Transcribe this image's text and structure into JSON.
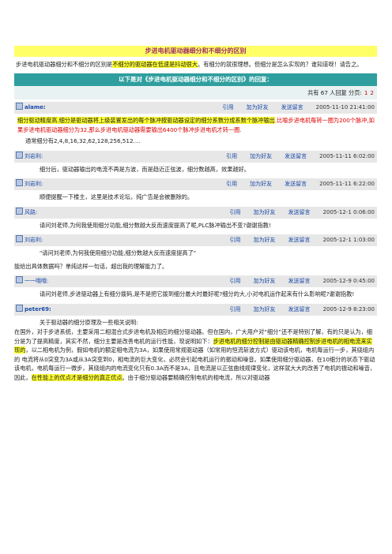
{
  "title": "步进电机驱动器细分和不细分的区别",
  "intro": {
    "pre": "步进电机驱动器细分和不细分的区别是",
    "hl": "不细分的驱动器在低速是抖动很大",
    "post": "。有细分的就很理想。但细分是怎么实现的？谁知道呀！请告之。"
  },
  "reply_header": "以下是对《步进电机驱动器细分和不细分的区别》的回复：",
  "count": {
    "text": "共有 67 人回复  分页:",
    "p1": "1",
    "p2": "2"
  },
  "actions": {
    "quote": "引用",
    "add_friend": "加为好友",
    "message": "发送留言"
  },
  "posts": [
    {
      "user": "alame:",
      "time": "2005-11-10 21:41:00",
      "hl": "细分驱动精度高.细分是驱动器将上级装置发出的每个脉冲按驱动器设定的细分系数分成系数个脉冲输出",
      "red": ".比喻步进电机每转一圈为200个脉冲,如果步进电机驱动器细分为32,那么步进电机驱动器需要输出6400个脉冲步进电机才转一圈.",
      "line2": "通常细分有2,4,8,16,32,62,128,256,512...."
    },
    {
      "user": "刘岩利:",
      "time": "2005-11-11 6:02:00",
      "text": "细分后，驱动器输出的电流不再是方波，而是趋近正弦波，细分数越高，效果越好。"
    },
    {
      "user": "刘岩利:",
      "time": "2005-11-11 6:22:00",
      "text": "顺便提醒一下楼主，这里是技术论坛，纯广告是会被删除的。"
    },
    {
      "user": "风路:",
      "time": "2005-12-1 0:06:00",
      "text": "请问刘老师,为何我使用细分功能,细分数越大反而速度提高了呢,PLC脉冲输出不变?谢谢指教!"
    },
    {
      "user": "刘岩利:",
      "time": "2005-12-1 1:03:00",
      "quote": "\"请问刘老师,为何我使用细分功能,细分数越大反而速度提高了\"",
      "text": "能给出具体数据吗？单纯这样一句话，超出我的理解能力了。"
    },
    {
      "user": "一一哦哦:",
      "time": "2005-12-9 0:45:00",
      "text": "请问刘老师,步进驱动器上有细分拨码,是不是把它拨到细分最大时最好呢?细分的大,小对电机运作起来有什么影响呢?谢谢指教!"
    },
    {
      "user": "peter69:",
      "time": "2005-12-9 8:23:00",
      "first": "关于驱动器的细分原理及一些相关说明:",
      "body_a": "在国外，对于步进系统，主要采用二相混合式步进电机及相应的细分驱动器。但在国内，广大用户对“细分”还不是特别了解，有的只是认为，细分是为了提高精度，其实不然，细分主要是改善电机的运行性能，现说明如下：",
      "body_hl": "步进电机的细分控制是由驱动器精确控制步进电机的相电流来实现的",
      "body_b": "，以二相电机为例，假如电机的额定相电流为3A，如果使用常规驱动器（如常用的恒流斩波方式）驱动该电机，电机每运行一步，其绕组内的   电流将从0突变为3A或从3A突变到0，相电流的巨大变化，必然会引起电机运行的振动和噪音。如果使用细分驱动器，在10细分的状态下驱动该电机，电机每运行一微步，其绕组内的电流变化只有0.3A而不是3A，且电流是以正弦曲线规律变化，这样就大大的改善了电机的振动和噪音，因此，",
      "body_hl2": "在性能上的优点才是细分的真正优点",
      "body_c": "。由于细分驱动器要精确控制电机的相电流，所以对驱动器"
    }
  ]
}
